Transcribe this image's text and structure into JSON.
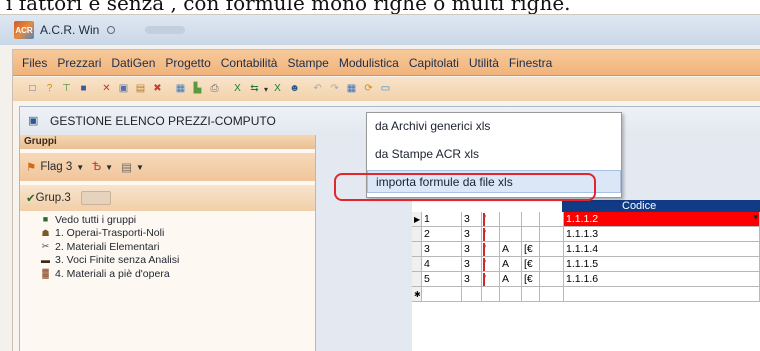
{
  "caption": "i fattori e senza , con formule mono righe o multi righe.",
  "app": {
    "title": "A.C.R. Win",
    "logo_text": "ACR",
    "title_icon": "circle-icon"
  },
  "menubar": {
    "items": [
      "Files",
      "Prezzari",
      "DatiGen",
      "Progetto",
      "Contabilità",
      "Stampe",
      "Modulistica",
      "Capitolati",
      "Utilità",
      "Finestra"
    ]
  },
  "toolbar": {
    "buttons": [
      {
        "name": "new-doc-icon",
        "glyph": "□",
        "color": "#3b62a8"
      },
      {
        "name": "open-icon",
        "glyph": "?",
        "color": "#d08a1a"
      },
      {
        "name": "tree-icon",
        "glyph": "⊤",
        "color": "#4d8a3a"
      },
      {
        "name": "save-icon",
        "glyph": "■",
        "color": "#3a5a9a"
      },
      {
        "name": "cut-icon",
        "glyph": "✕",
        "color": "#c0392b"
      },
      {
        "name": "copy-icon",
        "glyph": "▣",
        "color": "#5a6fa8"
      },
      {
        "name": "paste-icon",
        "glyph": "▤",
        "color": "#b77b2a"
      },
      {
        "name": "delete-icon",
        "glyph": "✖",
        "color": "#c43d3d"
      },
      {
        "name": "image-icon",
        "glyph": "▦",
        "color": "#3a7ac0"
      },
      {
        "name": "chart-icon",
        "glyph": "▙",
        "color": "#5a9a3a"
      },
      {
        "name": "print-icon",
        "glyph": "⎙",
        "color": "#6a6a6a"
      },
      {
        "name": "excel-icon",
        "glyph": "X",
        "color": "#1f7a3a"
      },
      {
        "name": "import-excel-icon",
        "glyph": "⇆",
        "color": "#1f7a3a"
      },
      {
        "name": "excel-export-icon",
        "glyph": "X",
        "color": "#1f7a3a"
      },
      {
        "name": "person-icon",
        "glyph": "☻",
        "color": "#2b5b8c"
      },
      {
        "name": "undo-icon",
        "glyph": "↶",
        "color": "#a8a8a8"
      },
      {
        "name": "redo-icon",
        "glyph": "↷",
        "color": "#a8a8a8"
      },
      {
        "name": "grid-icon",
        "glyph": "▦",
        "color": "#3b72c0"
      },
      {
        "name": "refresh-icon",
        "glyph": "⟳",
        "color": "#d08a1a"
      },
      {
        "name": "window-icon",
        "glyph": "▭",
        "color": "#3b8ad0"
      }
    ]
  },
  "panel": {
    "title": "GESTIONE ELENCO PREZZI-COMPUTO"
  },
  "groups": {
    "header": "Gruppi",
    "flag_label": "Flag 3",
    "group_label": "Grup.3",
    "items": [
      {
        "label": "Vedo tutti i gruppi",
        "icon": "all-groups-icon",
        "glyph": "■",
        "color": "#2a6a2a"
      },
      {
        "label": "1. Operai-Trasporti-Noli",
        "icon": "worker-icon",
        "glyph": "☗",
        "color": "#7a5a2a"
      },
      {
        "label": "2. Materiali Elementari",
        "icon": "materials-icon",
        "glyph": "✂",
        "color": "#4a4a4a"
      },
      {
        "label": "3. Voci Finite senza Analisi",
        "icon": "truck-icon",
        "glyph": "▬",
        "color": "#3a2a1a"
      },
      {
        "label": "4. Materiali a piè d'opera",
        "icon": "bricks-icon",
        "glyph": "▓",
        "color": "#8a4a2a"
      }
    ]
  },
  "dropdown": {
    "items": [
      "da Archivi generici xls",
      "da Stampe ACR xls",
      "importa formule da file xls"
    ],
    "highlighted_index": 2,
    "ring_color": "#e3262c"
  },
  "grid": {
    "header_label": "Codice",
    "rows": [
      {
        "indicator": "▶",
        "num": "1",
        "a": "3",
        "b": "'",
        "c": "",
        "d": "",
        "code": "1.1.1.2",
        "active": true
      },
      {
        "indicator": "",
        "num": "2",
        "a": "3",
        "b": "'",
        "c": "",
        "d": "",
        "code": "1.1.1.3",
        "active": false
      },
      {
        "indicator": "",
        "num": "3",
        "a": "3",
        "b": "'",
        "c": "A",
        "d": "[€",
        "code": "1.1.1.4",
        "active": false
      },
      {
        "indicator": "",
        "num": "4",
        "a": "3",
        "b": "'",
        "c": "A",
        "d": "[€",
        "code": "1.1.1.5",
        "active": false
      },
      {
        "indicator": "",
        "num": "5",
        "a": "3",
        "b": "'",
        "c": "A",
        "d": "[€",
        "code": "1.1.1.6",
        "active": false
      },
      {
        "indicator": "✱",
        "num": "",
        "a": "",
        "b": "",
        "c": "",
        "d": "",
        "code": "",
        "active": false
      }
    ]
  }
}
